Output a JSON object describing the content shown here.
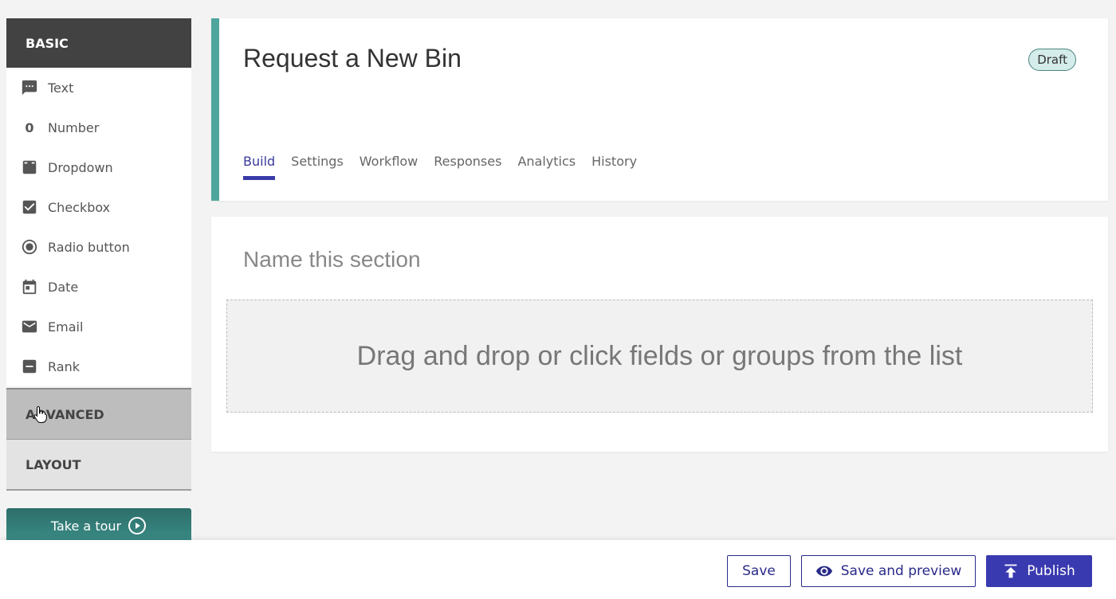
{
  "sidebar": {
    "basic_header": "BASIC",
    "fields": [
      {
        "label": "Text",
        "icon": "text-icon"
      },
      {
        "label": "Number",
        "icon": "number-icon",
        "glyph": "0"
      },
      {
        "label": "Dropdown",
        "icon": "dropdown-icon"
      },
      {
        "label": "Checkbox",
        "icon": "checkbox-icon"
      },
      {
        "label": "Radio button",
        "icon": "radio-icon"
      },
      {
        "label": "Date",
        "icon": "calendar-icon"
      },
      {
        "label": "Email",
        "icon": "email-icon"
      },
      {
        "label": "Rank",
        "icon": "rank-icon"
      }
    ],
    "advanced_header": "ADVANCED",
    "layout_header": "LAYOUT",
    "tour_label": "Take a tour"
  },
  "header": {
    "title": "Request a New Bin",
    "status_badge": "Draft",
    "tabs": [
      {
        "label": "Build",
        "active": true
      },
      {
        "label": "Settings",
        "active": false
      },
      {
        "label": "Workflow",
        "active": false
      },
      {
        "label": "Responses",
        "active": false
      },
      {
        "label": "Analytics",
        "active": false
      },
      {
        "label": "History",
        "active": false
      }
    ]
  },
  "section": {
    "name_placeholder": "Name this section",
    "dropzone_text": "Drag and drop or click fields or groups from the list"
  },
  "footer": {
    "save_label": "Save",
    "preview_label": "Save and preview",
    "publish_label": "Publish"
  },
  "colors": {
    "accent": "#3a3ab0",
    "teal": "#4ea59b",
    "sidebar_header": "#424242"
  }
}
